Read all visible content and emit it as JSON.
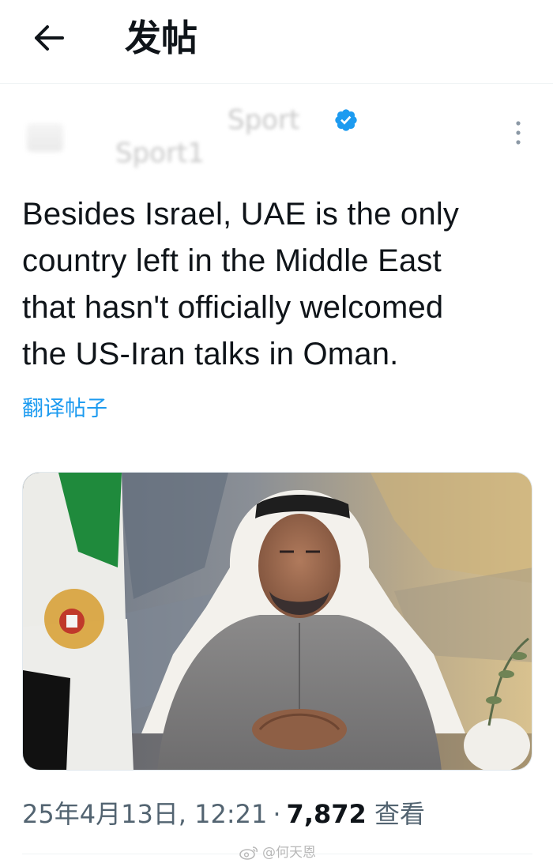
{
  "header": {
    "title": "发帖",
    "back_icon": "arrow-left-icon"
  },
  "author": {
    "display_name": "Sport",
    "handle": "Sport1",
    "verified_icon": "verified-badge-icon",
    "verified_color": "#1d9bf0",
    "more_icon": "more-vertical-icon"
  },
  "post": {
    "text_lines": [
      "Besides Israel, UAE is the only",
      "country left in the Middle East",
      "that hasn't officially welcomed",
      "the US-Iran talks in Oman."
    ],
    "translate_label": "翻译帖子",
    "link_color": "#1d9bf0"
  },
  "media": {
    "kind": "photo",
    "subject": "portrait-photo"
  },
  "meta": {
    "timestamp": "25年4月13日, 12:21",
    "separator": "·",
    "views_count": "7,872",
    "views_label": "查看"
  },
  "watermark": {
    "text": "@何天恩"
  }
}
